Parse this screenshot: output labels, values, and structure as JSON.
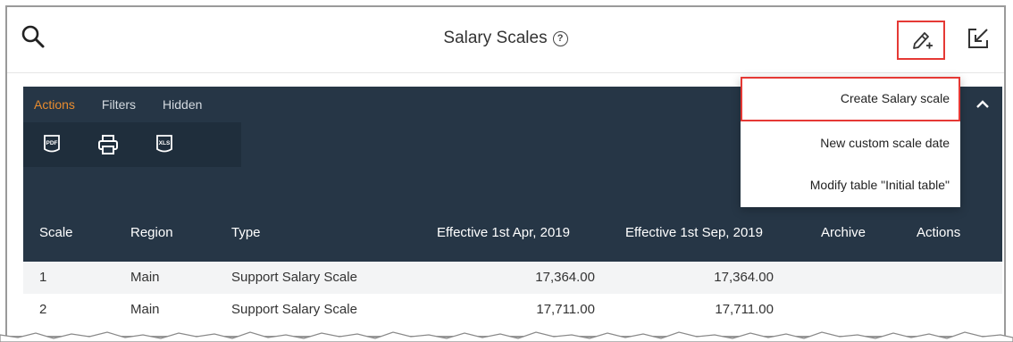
{
  "header": {
    "title": "Salary Scales",
    "help_glyph": "?"
  },
  "toolbar": {
    "tabs": [
      "Actions",
      "Filters",
      "Hidden"
    ],
    "active_tab": "Actions",
    "icons": [
      "pdf-export-icon",
      "print-icon",
      "xls-export-icon"
    ],
    "pdf_text": "PDF",
    "xls_text": "XLS"
  },
  "menu": {
    "items": [
      "Create Salary scale",
      "New custom scale date",
      "Modify table \"Initial table\""
    ]
  },
  "table": {
    "columns": [
      "Scale",
      "Region",
      "Type",
      "Effective 1st Apr, 2019",
      "Effective 1st Sep, 2019",
      "Archive",
      "Actions"
    ],
    "rows": [
      {
        "scale": "1",
        "region": "Main",
        "type": "Support Salary Scale",
        "apr": "17,364.00",
        "sep": "17,364.00"
      },
      {
        "scale": "2",
        "region": "Main",
        "type": "Support Salary Scale",
        "apr": "17,711.00",
        "sep": "17,711.00"
      }
    ]
  },
  "colors": {
    "dark_header": "#263646",
    "active_tab": "#e88c2f",
    "highlight_box": "#e53935"
  }
}
